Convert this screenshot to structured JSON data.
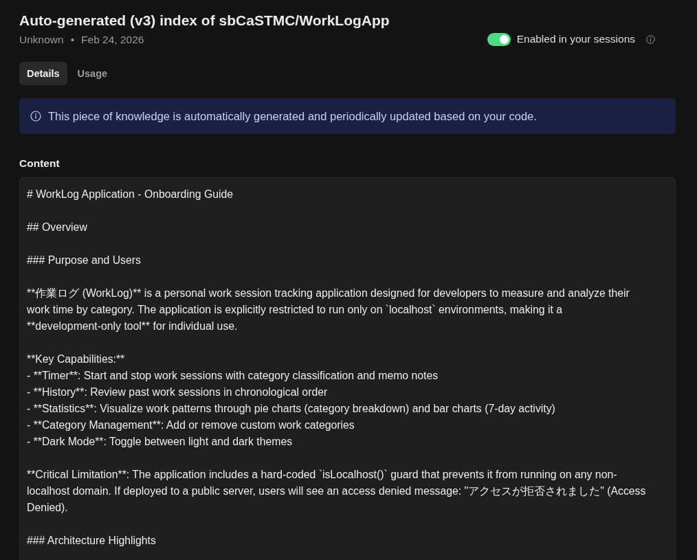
{
  "header": {
    "title": "Auto-generated (v3) index of sbCaSTMC/WorkLogApp",
    "author": "Unknown",
    "separator": "•",
    "date": "Feb 24, 2026"
  },
  "session_toggle": {
    "label": "Enabled in your sessions",
    "on": true
  },
  "tabs": [
    {
      "label": "Details",
      "selected": true
    },
    {
      "label": "Usage",
      "selected": false
    }
  ],
  "notice": {
    "text": "This piece of knowledge is automatically generated and periodically updated based on your code."
  },
  "content": {
    "label": "Content",
    "paragraphs": [
      {
        "lines": [
          "# WorkLog Application - Onboarding Guide"
        ]
      },
      {
        "lines": [
          "## Overview"
        ]
      },
      {
        "lines": [
          "### Purpose and Users"
        ]
      },
      {
        "lines": [
          "**作業ログ (WorkLog)** is a personal work session tracking application designed for developers to measure and analyze their",
          "work time by category. The application is explicitly restricted to run only on `localhost` environments, making it a",
          "**development-only tool** for individual use."
        ]
      },
      {
        "lines": [
          "**Key Capabilities:**",
          "- **Timer**: Start and stop work sessions with category classification and memo notes",
          "- **History**: Review past work sessions in chronological order",
          "- **Statistics**: Visualize work patterns through pie charts (category breakdown) and bar charts (7-day activity)",
          "- **Category Management**: Add or remove custom work categories",
          "- **Dark Mode**: Toggle between light and dark themes"
        ]
      },
      {
        "lines": [
          "**Critical Limitation**: The application includes a hard-coded `isLocalhost()` guard that prevents it from running on any non-",
          "localhost domain. If deployed to a public server, users will see an access denied message: \"アクセスが拒否されました\" (Access",
          "Denied)."
        ]
      },
      {
        "lines": [
          "### Architecture Highlights"
        ]
      }
    ]
  }
}
